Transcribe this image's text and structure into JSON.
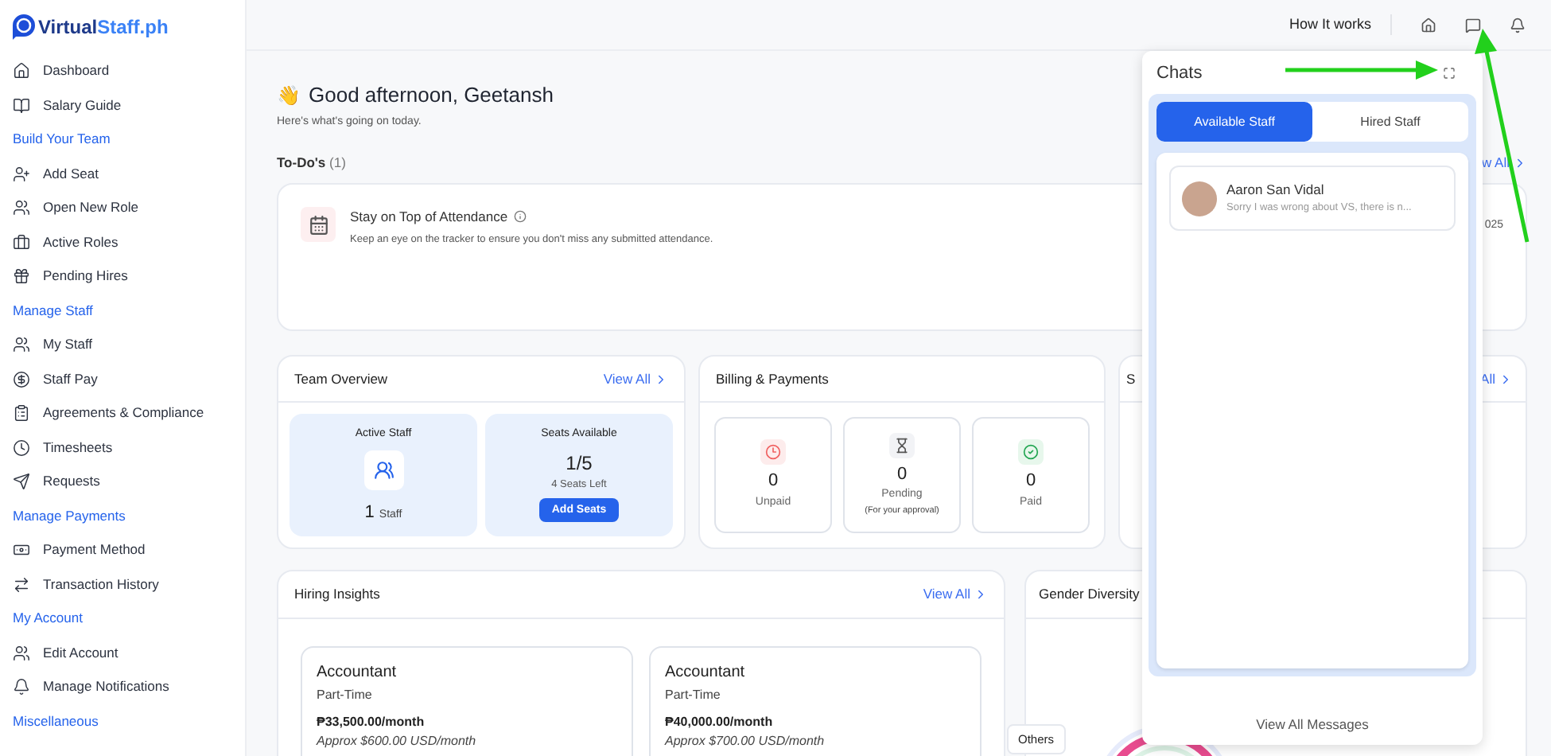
{
  "logo": {
    "primary": "Virtual",
    "secondary": "Staff.ph"
  },
  "sidebar": {
    "items": [
      {
        "kind": "link",
        "label": "Dashboard"
      },
      {
        "kind": "link",
        "label": "Salary Guide"
      },
      {
        "kind": "section",
        "label": "Build Your Team"
      },
      {
        "kind": "link",
        "label": "Add Seat"
      },
      {
        "kind": "link",
        "label": "Open New Role"
      },
      {
        "kind": "link",
        "label": "Active Roles"
      },
      {
        "kind": "link",
        "label": "Pending Hires"
      },
      {
        "kind": "section",
        "label": "Manage Staff"
      },
      {
        "kind": "link",
        "label": "My Staff"
      },
      {
        "kind": "link",
        "label": "Staff Pay"
      },
      {
        "kind": "link",
        "label": "Agreements & Compliance"
      },
      {
        "kind": "link",
        "label": "Timesheets"
      },
      {
        "kind": "link",
        "label": "Requests"
      },
      {
        "kind": "section",
        "label": "Manage Payments"
      },
      {
        "kind": "link",
        "label": "Payment Method"
      },
      {
        "kind": "link",
        "label": "Transaction History"
      },
      {
        "kind": "section",
        "label": "My Account"
      },
      {
        "kind": "link",
        "label": "Edit Account"
      },
      {
        "kind": "link",
        "label": "Manage Notifications"
      },
      {
        "kind": "section",
        "label": "Miscellaneous"
      }
    ]
  },
  "top_bar": {
    "link": "How It works"
  },
  "greeting": {
    "emoji": "👋",
    "title": "Good afternoon, Geetansh",
    "subtitle": "Here's what's going on today."
  },
  "todos": {
    "title": "To-Do's",
    "count": "(1)",
    "view_all": "w All",
    "items": [
      {
        "title": "Stay on Top of Attendance",
        "description": "Keep an eye on the tracker to ensure you don't miss any submitted attendance.",
        "date_fragment": "025"
      }
    ]
  },
  "team_overview": {
    "title": "Team Overview",
    "view_all": "View All",
    "active_staff": {
      "label": "Active Staff",
      "count": "1",
      "unit": "Staff"
    },
    "seats": {
      "label": "Seats Available",
      "value": "1/5",
      "left": "4 Seats Left",
      "button": "Add Seats"
    }
  },
  "billing": {
    "title": "Billing & Payments",
    "tiles": [
      {
        "kind": "unpaid",
        "value": "0",
        "label": "Unpaid"
      },
      {
        "kind": "pending",
        "value": "0",
        "label": "Pending",
        "note": "(For your approval)"
      },
      {
        "kind": "paid",
        "value": "0",
        "label": "Paid"
      }
    ]
  },
  "third_card": {
    "title_fragment": "S",
    "link_fragment": "All"
  },
  "hiring_insights": {
    "title": "Hiring Insights",
    "view_all": "View All",
    "cards": [
      {
        "title": "Accountant",
        "type": "Part-Time",
        "salary": "₱33,500.00/month",
        "approx": "Approx $600.00 USD/month"
      },
      {
        "title": "Accountant",
        "type": "Part-Time",
        "salary": "₱40,000.00/month",
        "approx": "Approx $700.00 USD/month"
      }
    ]
  },
  "gender_diversity": {
    "title": "Gender Diversity",
    "tooltip": "Others"
  },
  "chats": {
    "title": "Chats",
    "tabs": [
      {
        "label": "Available Staff",
        "selected": true
      },
      {
        "label": "Hired Staff",
        "selected": false
      }
    ],
    "conversations": [
      {
        "name": "Aaron San Vidal",
        "preview": "Sorry I was wrong about VS, there is n..."
      }
    ],
    "footer": "View All Messages"
  }
}
